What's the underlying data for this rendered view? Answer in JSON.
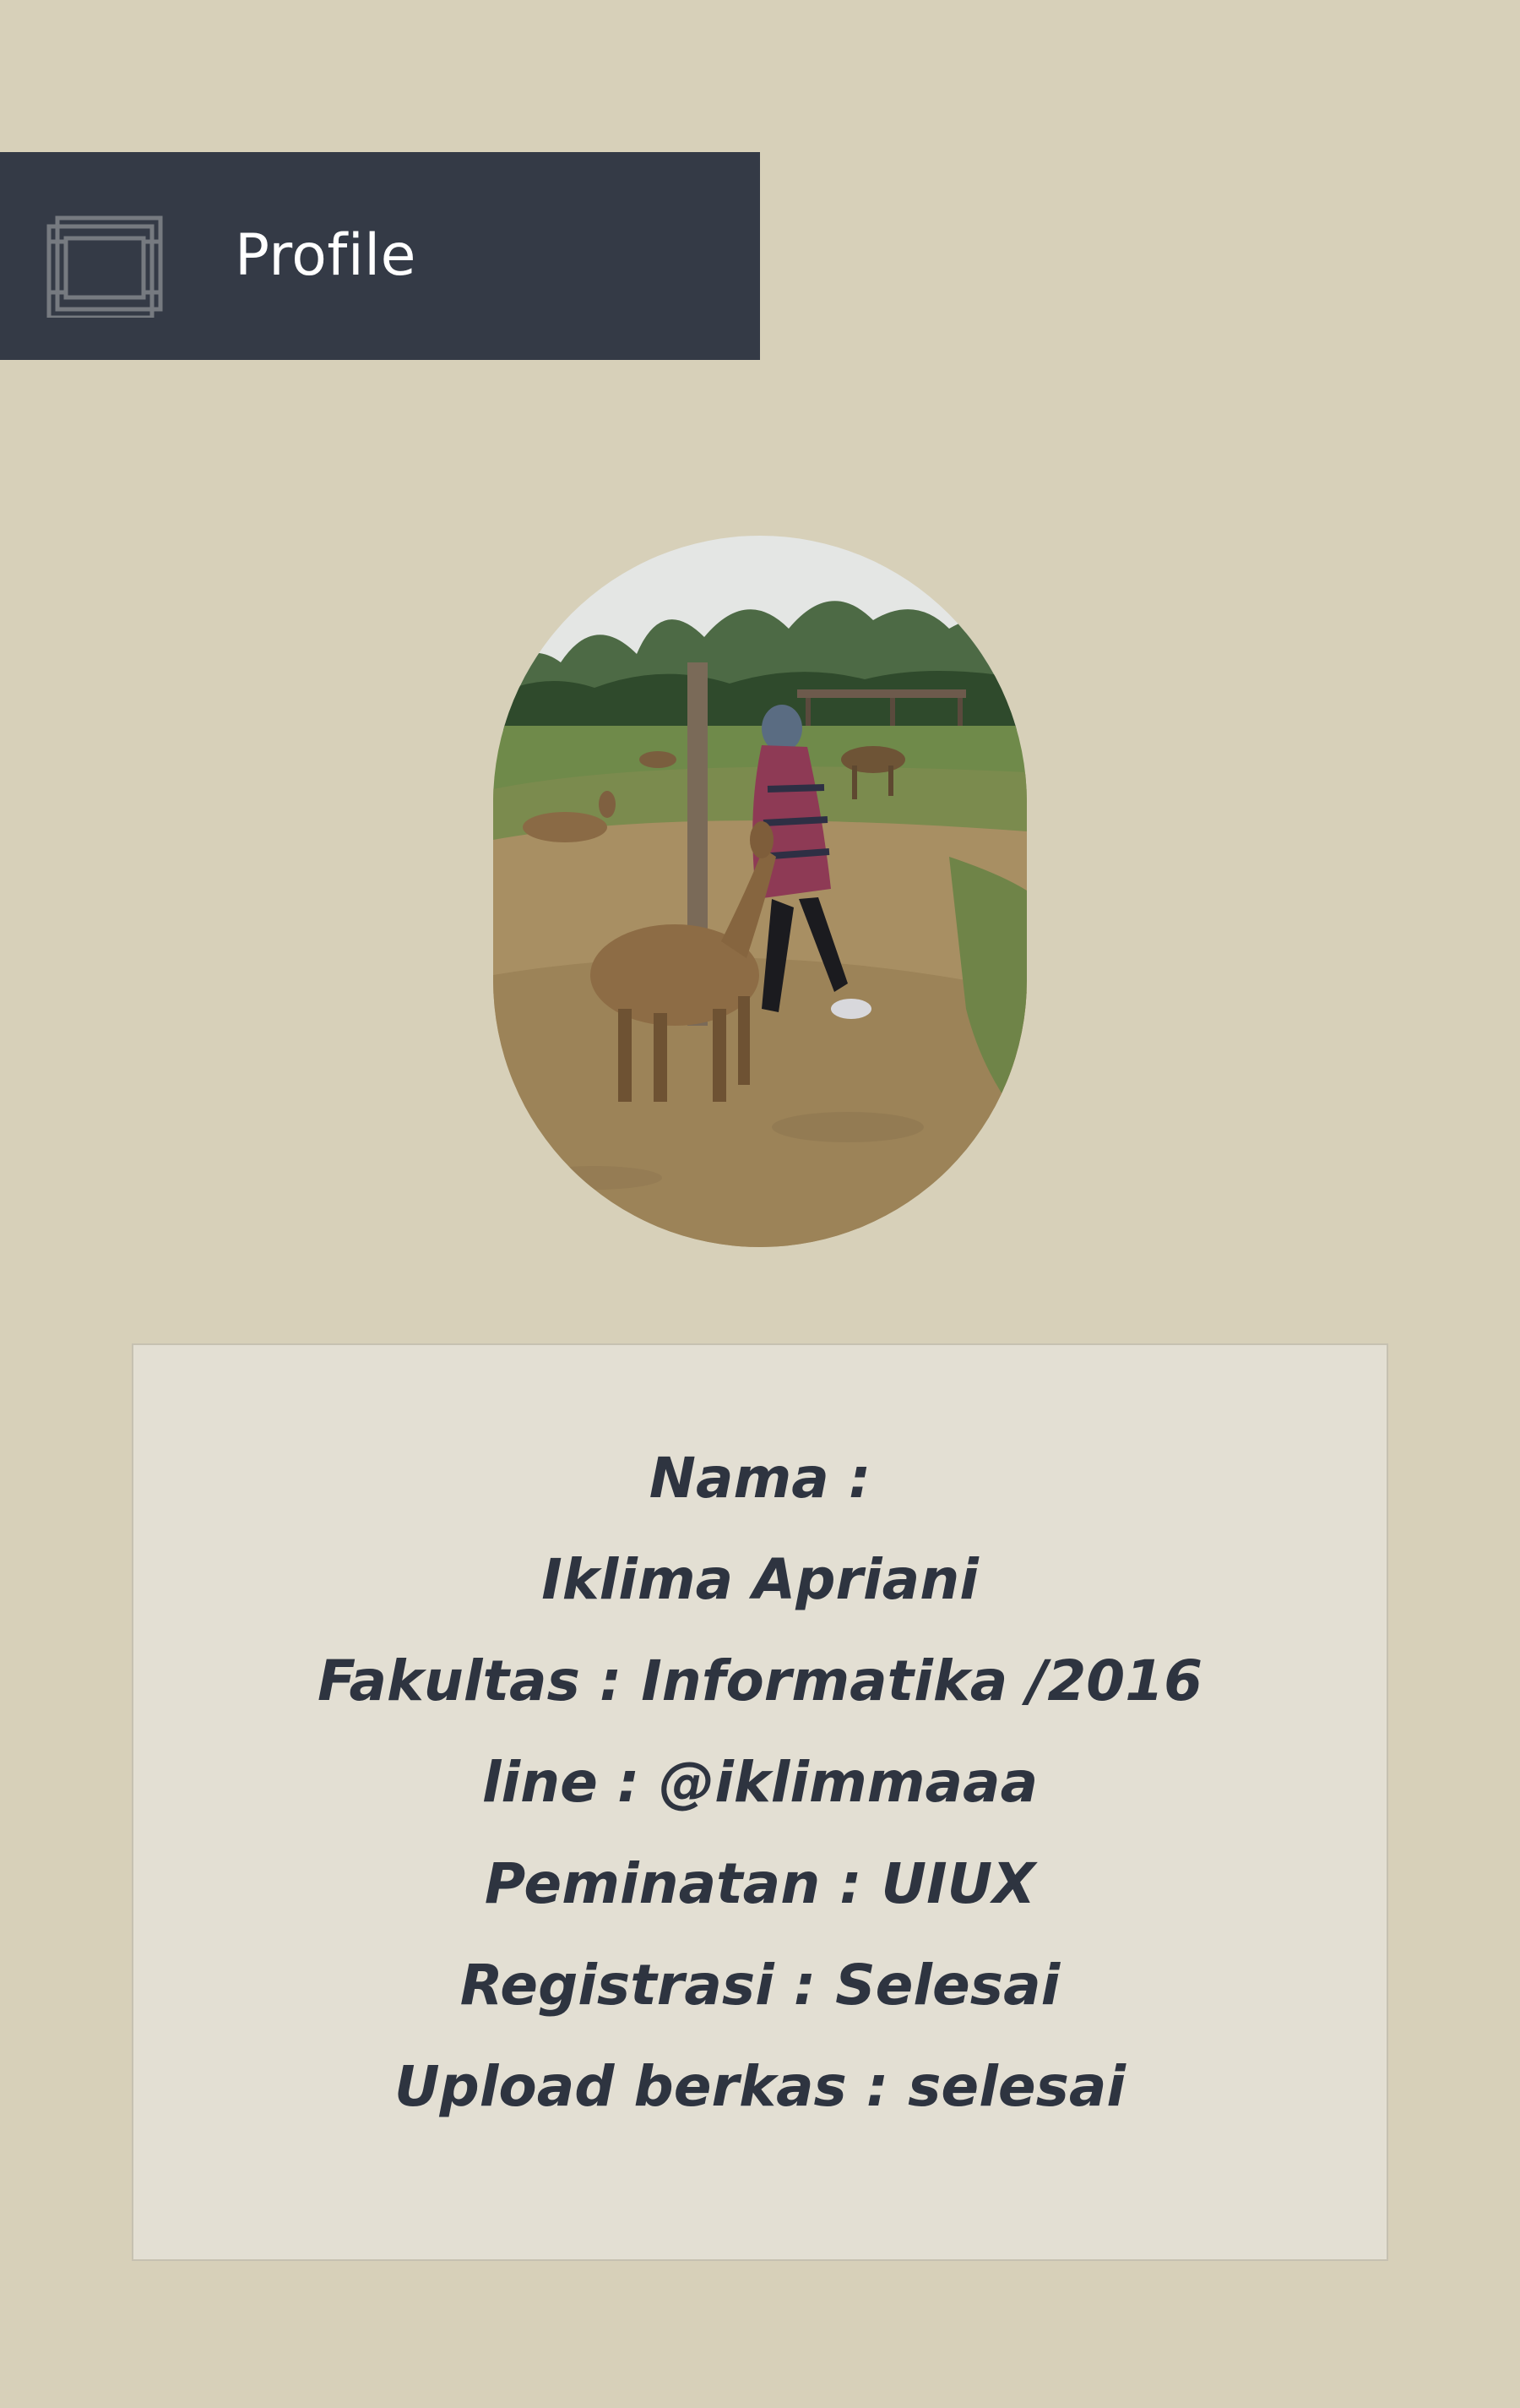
{
  "header": {
    "title": "Profile",
    "icon": "photo-frame-icon",
    "background": "#343a46"
  },
  "profile": {
    "photo": "profile-photo-with-deer"
  },
  "info": {
    "lines": [
      "Nama :",
      "Iklima Apriani",
      "Fakultas : Informatika /2016",
      "line : @iklimmaaa",
      "Peminatan : UIUX",
      "Registrasi : Selesai",
      "Upload berkas : selesai"
    ]
  },
  "colors": {
    "page_background": "#d7d0b9",
    "card_background": "#e3dfd3",
    "text": "#2e3440"
  }
}
